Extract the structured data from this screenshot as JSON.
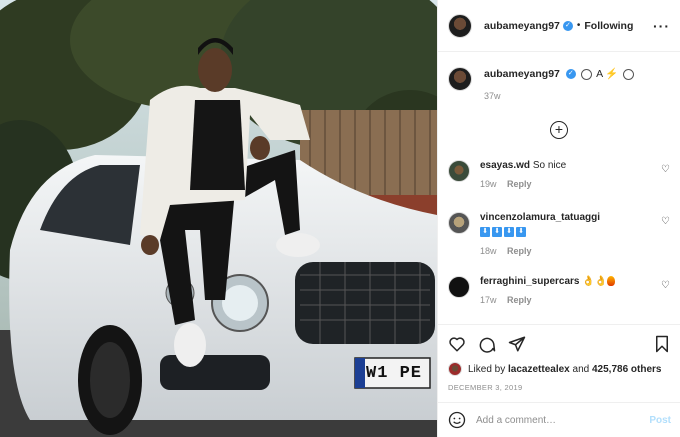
{
  "post": {
    "username": "aubameyang97",
    "follow_label": "Following",
    "more_icon": "more-options-icon"
  },
  "caption": {
    "username": "aubameyang97",
    "text_mid": "A",
    "age": "37w"
  },
  "photo": {
    "plate_text": "W1 PE"
  },
  "comments": [
    {
      "username": "esayas.wd",
      "text": "So nice",
      "age": "19w",
      "reply": "Reply"
    },
    {
      "username": "vincenzolamura_tatuaggi",
      "text": "⬇⬇⬇⬇",
      "age": "18w",
      "reply": "Reply"
    },
    {
      "username": "ferraghini_supercars",
      "text": "",
      "age": "17w",
      "reply": "Reply"
    }
  ],
  "likes": {
    "prefix": "Liked by",
    "user": "lacazettealex",
    "and": "and",
    "count": "425,786 others"
  },
  "date": "DECEMBER 3, 2019",
  "add_comment": {
    "placeholder": "Add a comment…",
    "post_label": "Post"
  },
  "colors": {
    "accent": "#3897f0",
    "post_disabled": "#b2dffc",
    "muted": "#8e8e8e"
  }
}
